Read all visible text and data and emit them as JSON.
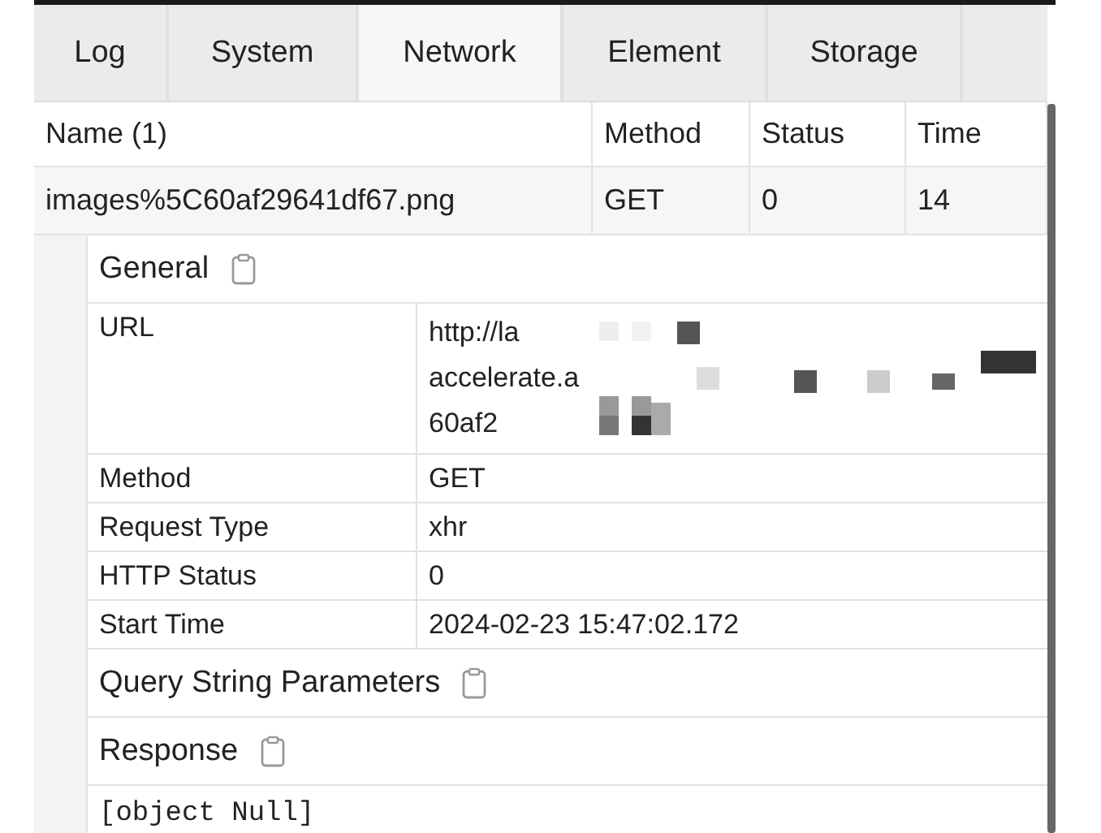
{
  "tabs": [
    {
      "label": "Log",
      "selected": false
    },
    {
      "label": "System",
      "selected": false
    },
    {
      "label": "Network",
      "selected": true
    },
    {
      "label": "Element",
      "selected": false
    },
    {
      "label": "Storage",
      "selected": false
    }
  ],
  "request_table": {
    "columns": [
      "Name (1)",
      "Method",
      "Status",
      "Time"
    ],
    "rows": [
      {
        "cells": [
          "images%5C60af29641df67.png",
          "GET",
          "0",
          "14"
        ],
        "selected": false
      }
    ]
  },
  "details": [
    {
      "kind": "fields",
      "title": "General",
      "rows": [
        {
          "label": "URL",
          "lines": [
            "http://la",
            "accelerate.a",
            "60af2"
          ],
          "redacted": true
        },
        {
          "label": "Method",
          "lines": [
            "GET"
          ],
          "redacted": false
        },
        {
          "label": "Request Type",
          "lines": [
            "xhr"
          ],
          "redacted": false
        },
        {
          "label": "HTTP Status",
          "lines": [
            "0"
          ],
          "redacted": false
        },
        {
          "label": "Start Time",
          "lines": [
            "2024-02-23 15:47:02.172"
          ],
          "redacted": false
        }
      ]
    },
    {
      "kind": "empty",
      "title": "Query String Parameters"
    },
    {
      "kind": "code",
      "title": "Response",
      "body": "[object Null]"
    }
  ]
}
